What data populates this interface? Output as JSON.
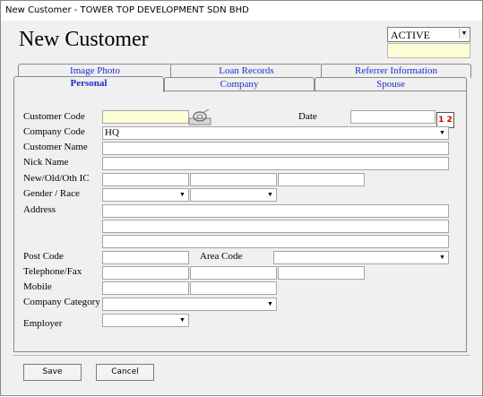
{
  "window": {
    "title": "New Customer - TOWER TOP DEVELOPMENT SDN BHD"
  },
  "header": {
    "title": "New Customer",
    "status_value": "ACTIVE"
  },
  "tabs_back": [
    "Image Photo",
    "Loan Records",
    "Referrer Information"
  ],
  "tabs_front": [
    "Personal",
    "Company",
    "Spouse"
  ],
  "form": {
    "customer_code": "Customer Code",
    "date": "Date",
    "company_code": "Company Code",
    "company_code_value": "HQ",
    "customer_name": "Customer Name",
    "nick_name": "Nick Name",
    "ic": "New/Old/Oth  IC",
    "gender_race": "Gender / Race",
    "address": "Address",
    "post_code": "Post Code",
    "area_code": "Area Code",
    "telephone_fax": "Telephone/Fax",
    "mobile": "Mobile",
    "company_category": "Company Category",
    "employer": "Employer",
    "calendar_text": "1 2"
  },
  "buttons": {
    "save": "Save",
    "cancel": "Cancel"
  },
  "colors": {
    "tab_text": "#1f2ad0",
    "highlight_field": "#ffffd6"
  }
}
